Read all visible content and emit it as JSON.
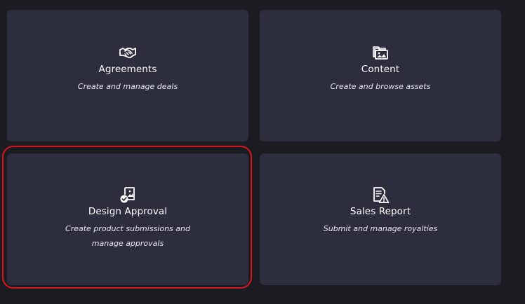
{
  "cards": [
    {
      "title": "Agreements",
      "description": "Create and manage deals",
      "icon": "handshake-icon"
    },
    {
      "title": "Content",
      "description": "Create and browse assets",
      "icon": "image-folder-icon"
    },
    {
      "title": "Design Approval",
      "description": "Create product submissions and manage approvals",
      "icon": "image-check-icon"
    },
    {
      "title": "Sales Report",
      "description": "Submit and manage royalties",
      "icon": "document-warning-icon"
    }
  ],
  "colors": {
    "background": "#1b1c21",
    "card": "#2c2d3d",
    "highlight": "#d7141f",
    "text": "#ffffff"
  }
}
